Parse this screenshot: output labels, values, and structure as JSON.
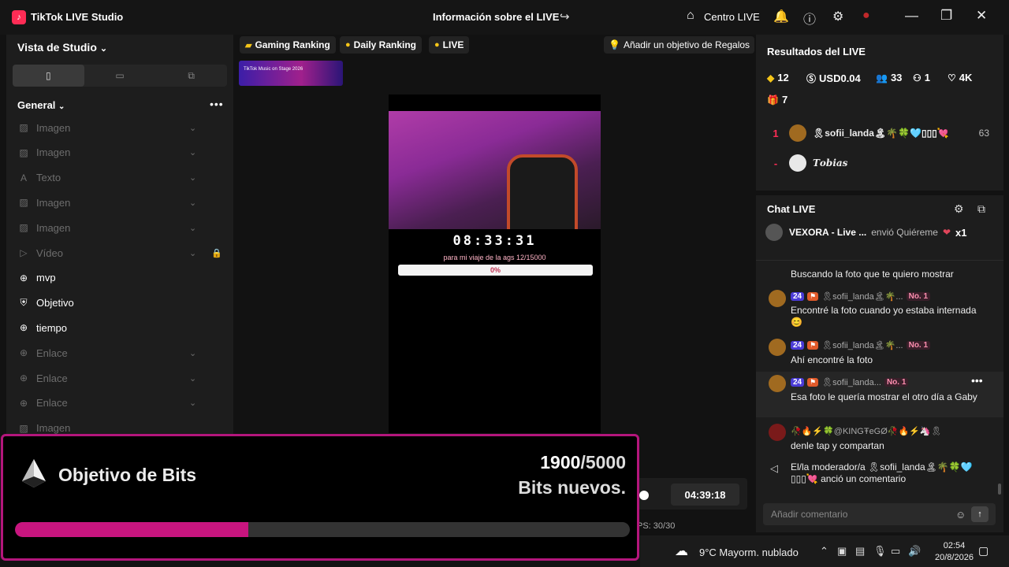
{
  "titlebar": {
    "app_name": "TikTok LIVE Studio",
    "live_info": "Información sobre el LIVE",
    "centro": "Centro LIVE"
  },
  "left": {
    "view_title": "Vista de Studio",
    "section": "General",
    "items": [
      {
        "icon": "image-icon",
        "label": "Imagen",
        "dim": true
      },
      {
        "icon": "image-icon",
        "label": "Imagen",
        "dim": true
      },
      {
        "icon": "text-icon",
        "label": "Texto",
        "dim": true
      },
      {
        "icon": "image-icon",
        "label": "Imagen",
        "dim": true
      },
      {
        "icon": "image-icon",
        "label": "Imagen",
        "dim": true
      },
      {
        "icon": "video-icon",
        "label": "Vídeo",
        "dim": true
      },
      {
        "icon": "globe-icon",
        "label": "mvp",
        "dim": false
      },
      {
        "icon": "shield-icon",
        "label": "Objetivo",
        "dim": false
      },
      {
        "icon": "globe-icon",
        "label": "tiempo",
        "dim": false
      },
      {
        "icon": "globe-icon",
        "label": "Enlace",
        "dim": true
      },
      {
        "icon": "globe-icon",
        "label": "Enlace",
        "dim": true
      },
      {
        "icon": "globe-icon",
        "label": "Enlace",
        "dim": true
      },
      {
        "icon": "image-icon",
        "label": "Imagen",
        "dim": true
      }
    ]
  },
  "center": {
    "gaming_ranking": "Gaming Ranking",
    "daily_ranking": "Daily Ranking",
    "live": "LIVE",
    "gift_goal": "Añadir un objetivo de Regalos",
    "banner_text": "TikTok Music on Stage 2026",
    "stream_timer": "08:33:31",
    "trip_label": "para mi viaje de la ags  12/15000",
    "trip_percent": "0%",
    "trip_progress": 0.0008,
    "duration": "04:39:18",
    "fps": "PS: 30/30"
  },
  "bits": {
    "title": "Objetivo de Bits",
    "current": "1900",
    "goal": "/5000",
    "subtitle": "Bits nuevos.",
    "progress": 0.38
  },
  "results": {
    "title": "Resultados del LIVE",
    "diamonds": "12",
    "usd": "USD0.04",
    "viewers": "33",
    "new_followers": "1",
    "likes": "4K",
    "gifters": "7",
    "ranking": [
      {
        "rank": "1",
        "name": "🎗sofii_landa🏝🌴🍀🩵▯▯▯💘",
        "score": "63"
      },
      {
        "rank": "-",
        "name": "𝑻𝒐𝒃𝒊𝒂𝒔",
        "score": ""
      }
    ]
  },
  "chat": {
    "title": "Chat LIVE",
    "gift": {
      "who": "VEXORA - Live ...",
      "action": "envió Quiéreme",
      "count": "x1"
    },
    "messages": [
      {
        "level": "24",
        "user": "🎗sofii_landa🏝🌴...",
        "rank": "No. 1",
        "text": "Encontré la foto cuando yo estaba internada😊"
      },
      {
        "level": "24",
        "user": "🎗sofii_landa🏝🌴...",
        "rank": "No. 1",
        "text": "Ahí encontré la foto"
      },
      {
        "level": "24",
        "user": "🎗sofii_landa...",
        "rank": "No. 1",
        "text": "Esa foto le quería mostrar el otro día a Gaby"
      },
      {
        "user": "🥀🔥⚡🍀@KINGŦeGØ🥀🔥⚡🦄🎗",
        "text": "denle tap y compartan"
      },
      {
        "text": "El/la moderador/a 🎗sofii_landa🏝🌴🍀🩵▯▯▯💘 anció un comentario"
      }
    ],
    "partial_top": "Buscando la foto que te quiero mostrar",
    "placeholder": "Añadir comentario"
  },
  "taskbar": {
    "weather": "9°C  Mayorm. nublado",
    "time": "02:54",
    "date": "20/8/2026"
  }
}
